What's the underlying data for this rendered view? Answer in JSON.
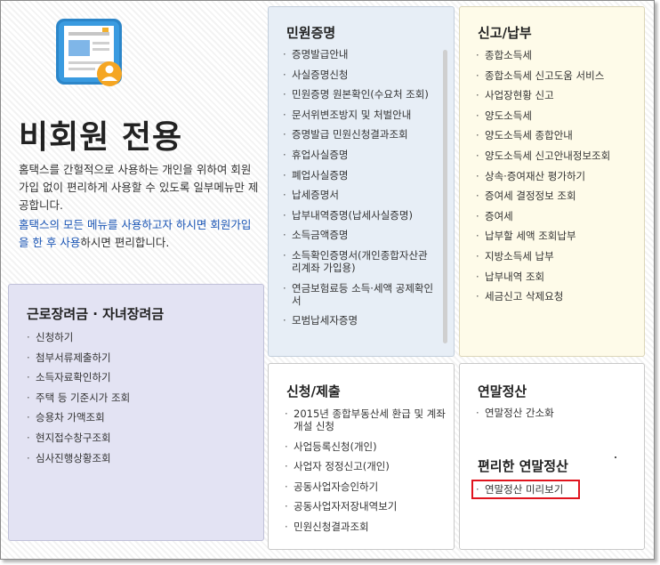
{
  "nonmember": {
    "title": "비회원 전용",
    "desc": "홈택스를 간헐적으로 사용하는 개인을 위하여 회원가입 없이 편리하게 사용할 수 있도록 일부메뉴만 제공합니다.",
    "highlight_blue": "홈택스의 모든 메뉴를 사용하고자 하시면 회원가입을 한 후 사용",
    "highlight_rest": "하시면 편리합니다."
  },
  "labor": {
    "title": "근로장려금 · 자녀장려금",
    "items": [
      "신청하기",
      "첨부서류제출하기",
      "소득자료확인하기",
      "주택 등 기준시가 조회",
      "승용차 가액조회",
      "현지접수창구조회",
      "심사진행상황조회"
    ]
  },
  "civil": {
    "title": "민원증명",
    "items": [
      "증명발급안내",
      "사실증명신청",
      "민원증명 원본확인(수요처 조회)",
      "문서위변조방지 및 처벌안내",
      "증명발급 민원신청결과조회",
      "휴업사실증명",
      "폐업사실증명",
      "납세증명서",
      "납부내역증명(납세사실증명)",
      "소득금액증명",
      "소득확인증명서(개인종합자산관리계좌 가입용)",
      "연금보험료등 소득·세액 공제확인서",
      "모범납세자증명"
    ]
  },
  "report": {
    "title": "신고/납부",
    "items": [
      "종합소득세",
      "종합소득세 신고도움 서비스",
      "사업장현황 신고",
      "양도소득세",
      "양도소득세 종합안내",
      "양도소득세 신고안내정보조회",
      "상속·증여재산 평가하기",
      "증여세 결정정보 조회",
      "증여세",
      "납부할 세액 조회납부",
      "지방소득세 납부",
      "납부내역 조회",
      "세금신고 삭제요청"
    ]
  },
  "apply": {
    "title": "신청/제출",
    "items": [
      "2015년 종합부동산세 환급 및 계좌개설 신청",
      "사업등록신청(개인)",
      "사업자 정정신고(개인)",
      "공동사업자승인하기",
      "공동사업자저장내역보기",
      "민원신청결과조회"
    ]
  },
  "yearend": {
    "title": "연말정산",
    "items": [
      "연말정산 간소화"
    ],
    "convenient_title": "편리한 연말정산",
    "convenient_items": [
      "연말정산 미리보기"
    ]
  },
  "colors": {
    "blue_text": "#1a55b5",
    "highlight_red": "#e0141e",
    "labor_bg": "#e3e3f3",
    "civil_bg": "#e7eef6",
    "report_bg": "#fefbe9"
  },
  "icons": {
    "nonmember": "document-user-icon"
  }
}
